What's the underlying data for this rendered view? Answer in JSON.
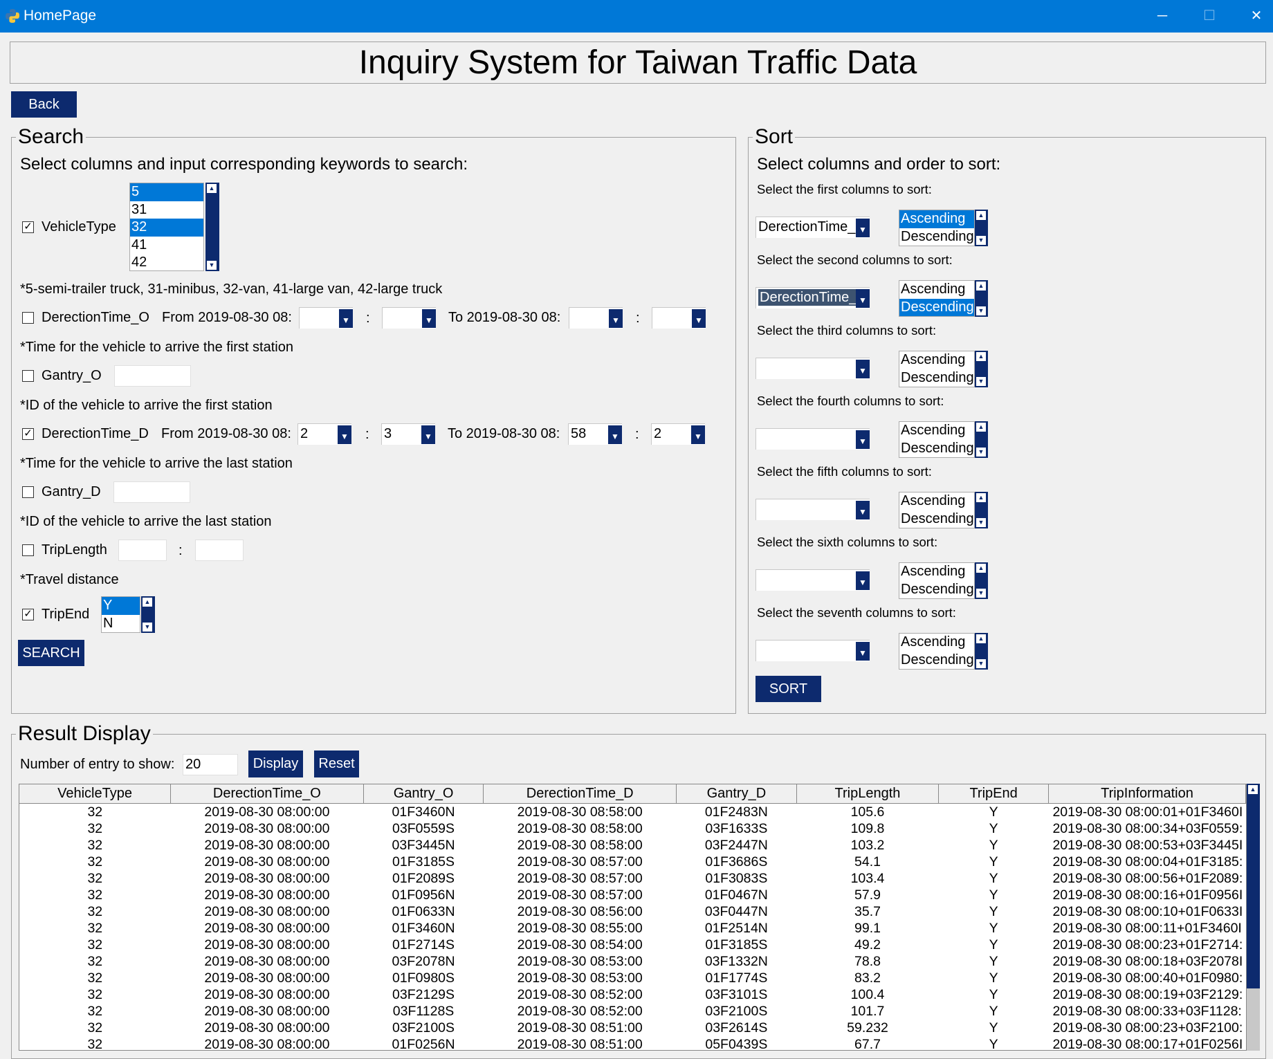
{
  "window": {
    "title": "HomePage"
  },
  "header": {
    "title": "Inquiry System for Taiwan Traffic Data",
    "back_label": "Back"
  },
  "search": {
    "label": "Search",
    "instruction": "Select columns and input corresponding keywords to search:",
    "vehicle_type": {
      "label": "VehicleType",
      "checked": true,
      "options": [
        "5",
        "31",
        "32",
        "41",
        "42"
      ],
      "selected": [
        "5",
        "32"
      ],
      "note": "*5-semi-trailer truck, 31-minibus, 32-van, 41-large van, 42-large truck"
    },
    "direction_time_o": {
      "label": "DerectionTime_O",
      "checked": false,
      "from_label": "From 2019-08-30 08:",
      "to_label": "To 2019-08-30 08:",
      "from_min": "",
      "from_sec": "",
      "to_min": "",
      "to_sec": "",
      "note": "*Time for the vehicle to arrive the first station"
    },
    "gantry_o": {
      "label": "Gantry_O",
      "checked": false,
      "value": "",
      "note": "*ID of the vehicle to arrive the first station"
    },
    "direction_time_d": {
      "label": "DerectionTime_D",
      "checked": true,
      "from_label": "From 2019-08-30 08:",
      "to_label": "To 2019-08-30 08:",
      "from_min": "2",
      "from_sec": "3",
      "to_min": "58",
      "to_sec": "2",
      "note": "*Time for the vehicle to arrive the last station"
    },
    "gantry_d": {
      "label": "Gantry_D",
      "checked": false,
      "value": "",
      "note": "*ID of the vehicle to arrive the last station"
    },
    "trip_length": {
      "label": "TripLength",
      "checked": false,
      "from": "",
      "to": "",
      "note": "*Travel distance"
    },
    "trip_end": {
      "label": "TripEnd",
      "checked": true,
      "options": [
        "Y",
        "N"
      ],
      "selected": [
        "Y"
      ]
    },
    "colon": ":",
    "search_label": "SEARCH"
  },
  "sort": {
    "label": "Sort",
    "instruction": "Select columns and order to sort:",
    "ascending": "Ascending",
    "descending": "Descending",
    "rows": [
      {
        "prompt": "Select the first columns to sort:",
        "column": "DerectionTime_O",
        "order": "Ascending"
      },
      {
        "prompt": "Select the second columns to sort:",
        "column": "DerectionTime_D",
        "order": "Descending"
      },
      {
        "prompt": "Select the third columns to sort:",
        "column": "",
        "order": ""
      },
      {
        "prompt": "Select the fourth columns to sort:",
        "column": "",
        "order": ""
      },
      {
        "prompt": "Select the fifth columns to sort:",
        "column": "",
        "order": ""
      },
      {
        "prompt": "Select the sixth columns to sort:",
        "column": "",
        "order": ""
      },
      {
        "prompt": "Select the seventh columns to sort:",
        "column": "",
        "order": ""
      }
    ],
    "sort_label": "SORT"
  },
  "result": {
    "label": "Result Display",
    "entries_label": "Number of entry to show:",
    "entries_value": "20",
    "display_label": "Display",
    "reset_label": "Reset",
    "columns": [
      "VehicleType",
      "DerectionTime_O",
      "Gantry_O",
      "DerectionTime_D",
      "Gantry_D",
      "TripLength",
      "TripEnd",
      "TripInformation"
    ],
    "rows": [
      [
        "32",
        "2019-08-30 08:00:00",
        "01F3460N",
        "2019-08-30 08:58:00",
        "01F2483N",
        "105.6",
        "Y",
        "2019-08-30 08:00:01+01F3460I"
      ],
      [
        "32",
        "2019-08-30 08:00:00",
        "03F0559S",
        "2019-08-30 08:58:00",
        "03F1633S",
        "109.8",
        "Y",
        "2019-08-30 08:00:34+03F0559:"
      ],
      [
        "32",
        "2019-08-30 08:00:00",
        "03F3445N",
        "2019-08-30 08:58:00",
        "03F2447N",
        "103.2",
        "Y",
        "2019-08-30 08:00:53+03F3445I"
      ],
      [
        "32",
        "2019-08-30 08:00:00",
        "01F3185S",
        "2019-08-30 08:57:00",
        "01F3686S",
        "54.1",
        "Y",
        "2019-08-30 08:00:04+01F3185:"
      ],
      [
        "32",
        "2019-08-30 08:00:00",
        "01F2089S",
        "2019-08-30 08:57:00",
        "01F3083S",
        "103.4",
        "Y",
        "2019-08-30 08:00:56+01F2089:"
      ],
      [
        "32",
        "2019-08-30 08:00:00",
        "01F0956N",
        "2019-08-30 08:57:00",
        "01F0467N",
        "57.9",
        "Y",
        "2019-08-30 08:00:16+01F0956I"
      ],
      [
        "32",
        "2019-08-30 08:00:00",
        "01F0633N",
        "2019-08-30 08:56:00",
        "03F0447N",
        "35.7",
        "Y",
        "2019-08-30 08:00:10+01F0633I"
      ],
      [
        "32",
        "2019-08-30 08:00:00",
        "01F3460N",
        "2019-08-30 08:55:00",
        "01F2514N",
        "99.1",
        "Y",
        "2019-08-30 08:00:11+01F3460I"
      ],
      [
        "32",
        "2019-08-30 08:00:00",
        "01F2714S",
        "2019-08-30 08:54:00",
        "01F3185S",
        "49.2",
        "Y",
        "2019-08-30 08:00:23+01F2714:"
      ],
      [
        "32",
        "2019-08-30 08:00:00",
        "03F2078N",
        "2019-08-30 08:53:00",
        "03F1332N",
        "78.8",
        "Y",
        "2019-08-30 08:00:18+03F2078I"
      ],
      [
        "32",
        "2019-08-30 08:00:00",
        "01F0980S",
        "2019-08-30 08:53:00",
        "01F1774S",
        "83.2",
        "Y",
        "2019-08-30 08:00:40+01F0980:"
      ],
      [
        "32",
        "2019-08-30 08:00:00",
        "03F2129S",
        "2019-08-30 08:52:00",
        "03F3101S",
        "100.4",
        "Y",
        "2019-08-30 08:00:19+03F2129:"
      ],
      [
        "32",
        "2019-08-30 08:00:00",
        "03F1128S",
        "2019-08-30 08:52:00",
        "03F2100S",
        "101.7",
        "Y",
        "2019-08-30 08:00:33+03F1128:"
      ],
      [
        "32",
        "2019-08-30 08:00:00",
        "03F2100S",
        "2019-08-30 08:51:00",
        "03F2614S",
        "59.232",
        "Y",
        "2019-08-30 08:00:23+03F2100:"
      ],
      [
        "32",
        "2019-08-30 08:00:00",
        "01F0256N",
        "2019-08-30 08:51:00",
        "05F0439S",
        "67.7",
        "Y",
        "2019-08-30 08:00:17+01F0256I"
      ]
    ]
  }
}
